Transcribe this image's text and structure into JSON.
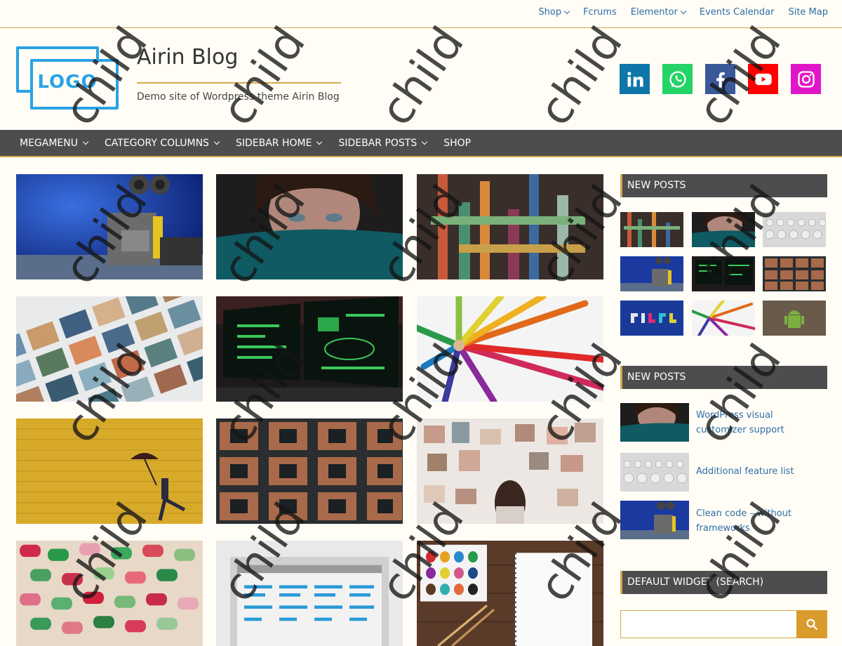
{
  "topnav": {
    "items": [
      {
        "label": "Shop",
        "has_dropdown": true
      },
      {
        "label": "Fcrums",
        "has_dropdown": false
      },
      {
        "label": "Elementor",
        "has_dropdown": true
      },
      {
        "label": "Events Calendar",
        "has_dropdown": false
      },
      {
        "label": "Site Map",
        "has_dropdown": false
      }
    ]
  },
  "header": {
    "logo_text": "LOGO",
    "site_title": "Airin Blog",
    "tagline": "Demo site of Wordpress theme Airin Blog"
  },
  "social": [
    {
      "icon": "linkedin-icon",
      "color": "#0e76a8"
    },
    {
      "icon": "whatsapp-icon",
      "color": "#25d366"
    },
    {
      "icon": "facebook-icon",
      "color": "#3b5998"
    },
    {
      "icon": "youtube-icon",
      "color": "#ff0000"
    },
    {
      "icon": "instagram-icon",
      "color": "#e017c9"
    }
  ],
  "mainnav": {
    "items": [
      {
        "label": "MEGAMENU",
        "has_dropdown": true
      },
      {
        "label": "CATEGORY COLUMNS",
        "has_dropdown": true
      },
      {
        "label": "SIDEBAR HOME",
        "has_dropdown": true
      },
      {
        "label": "SIDEBAR POSTS",
        "has_dropdown": true
      },
      {
        "label": "SHOP",
        "has_dropdown": false
      }
    ]
  },
  "grid": {
    "thumbnails": [
      "robot",
      "woman-eyes",
      "colored-blocks",
      "photo-prints",
      "computer-monitors",
      "colored-pencils",
      "umbrella-yellow-wall",
      "city-aerial",
      "moodboard-wall",
      "colorful-shapes",
      "wireframe-layout",
      "watercolor-notebook"
    ]
  },
  "sidebar": {
    "widget1_title": "NEW POSTS",
    "widget2_title": "NEW POSTS",
    "widget3_title": "DEFAULT WIDGET (SEARCH)",
    "recent_posts": [
      {
        "title": "WordPress visual customizer support"
      },
      {
        "title": "Additional feature list"
      },
      {
        "title": "Clean code – without frameworks"
      }
    ],
    "search_placeholder": ""
  },
  "watermark": "child",
  "colors": {
    "accent": "#d4a84a",
    "nav_bg": "#4d4d4d",
    "link": "#2f6ea8",
    "page_bg": "#fffdf6",
    "search_button": "#d99b2b"
  }
}
